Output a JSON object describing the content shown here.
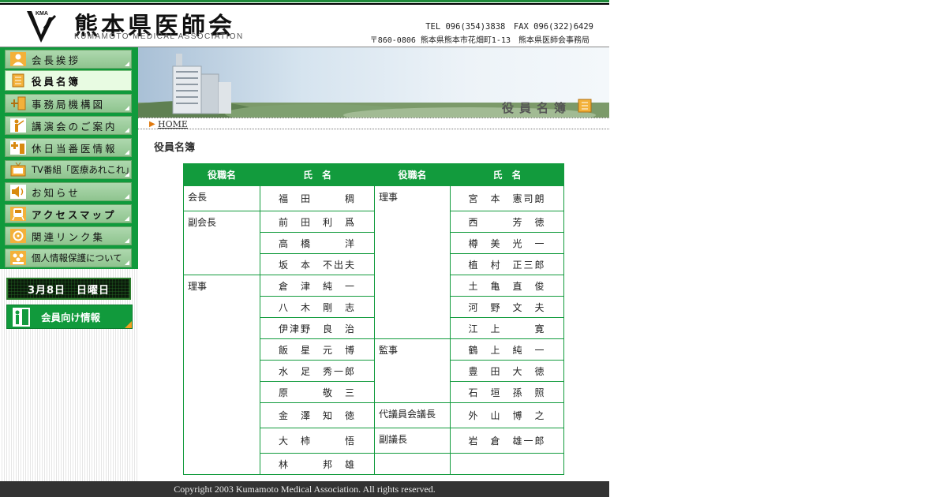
{
  "header": {
    "logo_text": "KMA",
    "title_jp": "熊本県医師会",
    "title_en": "KUMAMOTO MEDICAL ASSOCIATION",
    "contact_line1": "TEL 096(354)3838　FAX 096(322)6429",
    "contact_line2": "〒860-0806 熊本県熊本市花畑町1-13　熊本県医師会事務局"
  },
  "sidebar": {
    "items": [
      {
        "label": "会長挨拶",
        "icon": "person-icon",
        "active": false
      },
      {
        "label": "役員名簿",
        "icon": "roster-book-icon",
        "active": true
      },
      {
        "label": "事務局機構図",
        "icon": "org-chart-icon",
        "active": false
      },
      {
        "label": "講演会のご案内",
        "icon": "lecture-icon",
        "active": false
      },
      {
        "label": "休日当番医情報",
        "icon": "medical-cross-icon",
        "active": false
      },
      {
        "label": "TV番組「医療あれこれ」",
        "icon": "tv-icon",
        "active": false
      },
      {
        "label": "お知らせ",
        "icon": "speaker-icon",
        "active": false
      },
      {
        "label": "アクセスマップ",
        "icon": "train-icon",
        "active": false
      },
      {
        "label": "関連リンク集",
        "icon": "link-icon",
        "active": false
      },
      {
        "label": "個人情報保護について",
        "icon": "people-icon",
        "active": false
      }
    ],
    "date": "3月8日　日曜日",
    "member_button": "会員向け情報"
  },
  "banner": {
    "title": "役員名簿"
  },
  "breadcrumb": {
    "home": "HOME"
  },
  "page_title": "役員名簿",
  "table": {
    "headers": [
      "役職名",
      "氏　名",
      "役職名",
      "氏　名"
    ],
    "left": [
      {
        "role": "会長",
        "names": [
          "福　田　　　稠"
        ]
      },
      {
        "role": "副会長",
        "names": [
          "前　田　利　爲",
          "高　橋　　　洋",
          "坂　本　不出夫"
        ]
      },
      {
        "role": "理事",
        "names": [
          "倉　津　純　一",
          "八　木　剛　志",
          "伊津野　良　治",
          "飯　星　元　博",
          "水　足　秀一郎",
          "原　　　敬　三",
          "金　澤　知　徳",
          "大　柿　　　悟",
          "林　　　邦　雄"
        ]
      }
    ],
    "right": [
      {
        "role": "理事",
        "names": [
          "宮　本　憲司朗",
          "西　　　芳　徳",
          "樽　美　光　一",
          "植　村　正三郎",
          "土　亀　直　俊",
          "河　野　文　夫",
          "江　上　　　寛"
        ]
      },
      {
        "role": "監事",
        "names": [
          "鶴　上　純　一",
          "豊　田　大　徳",
          "石　垣　孫　照"
        ]
      },
      {
        "role": "代議員会議長",
        "names": [
          "外　山　博　之"
        ]
      },
      {
        "role": "副議長",
        "names": [
          "岩　倉　雄一郎"
        ]
      }
    ]
  },
  "footer": {
    "copyright": "Copyright 2003 Kumamoto Medical Association. All rights reserved."
  },
  "colors": {
    "brand_green": "#129b3d",
    "footer_bg": "#333333",
    "accent_orange": "#e07a10"
  }
}
